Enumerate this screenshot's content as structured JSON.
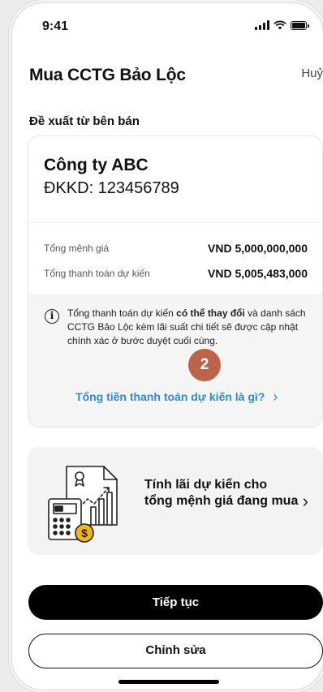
{
  "status_bar": {
    "time": "9:41"
  },
  "header": {
    "title": "Mua CCTG Bảo Lộc",
    "cancel_label": "Huỷ"
  },
  "section_label": "Đề xuất từ bên bán",
  "seller": {
    "name": "Công ty ABC",
    "registration": "ĐKKD: 123456789",
    "rows": [
      {
        "label": "Tổng mệnh giá",
        "value": "VND 5,000,000,000"
      },
      {
        "label": "Tổng thanh toán dự kiến",
        "value": "VND 5,005,483,000"
      }
    ]
  },
  "info": {
    "text_before": "Tổng thanh toán dự kiến ",
    "text_bold": "có thể thay đổi",
    "text_after": " và danh sách CCTG Bảo Lộc kèm lãi suất chi tiết sẽ được cập nhật chính xác ở bước duyệt cuối cùng.",
    "link_label": "Tổng tiền thanh toán dự kiến là gì?"
  },
  "step_badge": "2",
  "interest_card": {
    "label": "Tính lãi dự kiến cho tổng mệnh giá đang mua"
  },
  "actions": {
    "continue_label": "Tiếp tục",
    "edit_label": "Chỉnh sửa"
  },
  "colors": {
    "link": "#2d8bdc",
    "badge": "#b45032",
    "accent_gold": "#f2b51c"
  }
}
